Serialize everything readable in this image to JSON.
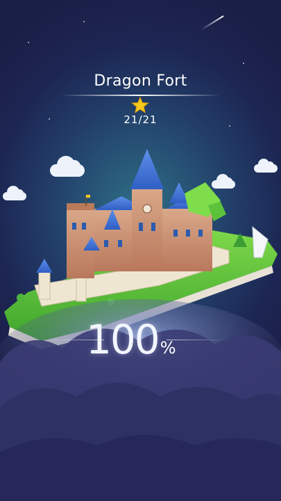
{
  "level": {
    "name": "Dragon Fort",
    "progress_label": "21/21",
    "stars_earned": 1
  },
  "completion": {
    "value": "100",
    "unit": "%",
    "fraction": 1.0
  },
  "icons": {
    "star": "star-icon",
    "flag": "flag-icon"
  },
  "colors": {
    "background_top": "#1a1f47",
    "background_glow": "#2f6f86",
    "star_gold": "#f6c91c",
    "roof_blue": "#3b6fd8",
    "grass_green": "#6ccf3a",
    "wall_cream": "#efe6d2"
  }
}
